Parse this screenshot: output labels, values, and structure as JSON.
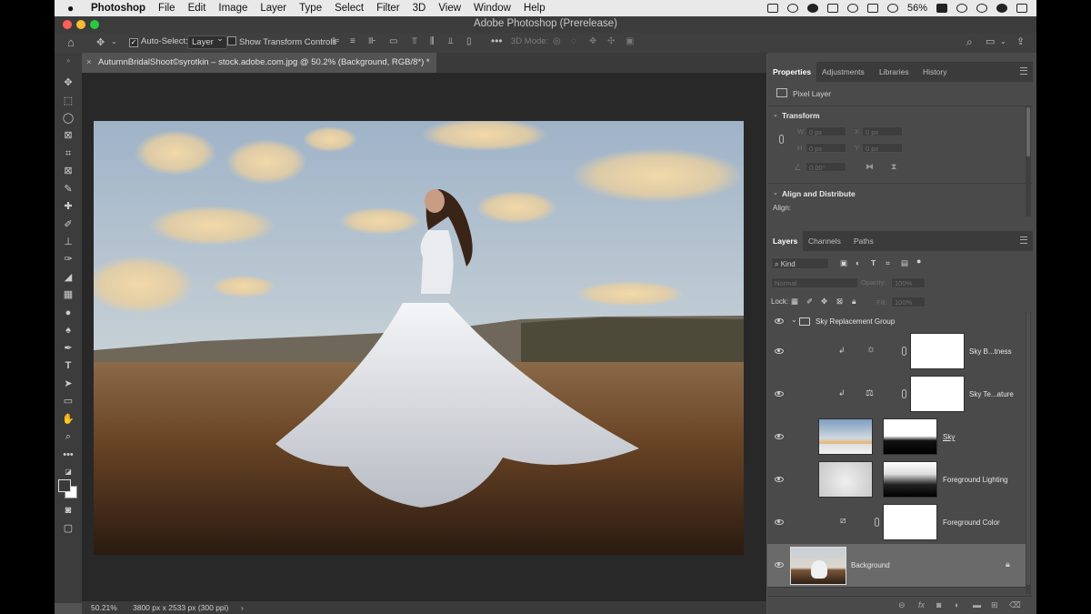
{
  "menubar": {
    "app": "Photoshop",
    "items": [
      "File",
      "Edit",
      "Image",
      "Layer",
      "Type",
      "Select",
      "Filter",
      "3D",
      "View",
      "Window",
      "Help"
    ],
    "battery": "56%"
  },
  "window": {
    "title": "Adobe Photoshop (Prerelease)"
  },
  "options": {
    "auto_select_label": "Auto-Select:",
    "auto_select_value": "Layer",
    "transform_controls_label": "Show Transform Controls",
    "mode_3d_label": "3D Mode:"
  },
  "document_tab": {
    "title": "AutumnBridalShoot©syrotkin – stock.adobe.com.jpg @ 50.2% (Background, RGB/8*) *"
  },
  "status": {
    "zoom": "50.21%",
    "doc_info": "3800 px x 2533 px (300 ppi)"
  },
  "properties_panel": {
    "tabs": [
      "Properties",
      "Adjustments",
      "Libraries",
      "History"
    ],
    "layer_type": "Pixel Layer",
    "transform_header": "Transform",
    "w_label": "W",
    "w_value": "0 px",
    "h_label": "H",
    "h_value": "0 px",
    "x_label": "X",
    "x_value": "0 px",
    "y_label": "Y",
    "y_value": "0 px",
    "angle_value": "0.00°",
    "align_header": "Align and Distribute",
    "align_label": "Align:"
  },
  "layers_panel": {
    "tabs": [
      "Layers",
      "Channels",
      "Paths"
    ],
    "kind_filter": "Kind",
    "blend_mode": "Normal",
    "opacity_label": "Opacity:",
    "opacity_value": "100%",
    "lock_label": "Lock:",
    "fill_label": "Fill:",
    "fill_value": "100%",
    "layers": [
      {
        "name": "Sky Replacement Group",
        "type": "group"
      },
      {
        "name": "Sky B...tness",
        "type": "adjustment"
      },
      {
        "name": "Sky Te...ature",
        "type": "adjustment"
      },
      {
        "name": "Sky",
        "type": "pixel"
      },
      {
        "name": "Foreground Lighting",
        "type": "pixel"
      },
      {
        "name": "Foreground Color",
        "type": "fill"
      },
      {
        "name": "Background",
        "type": "background"
      }
    ]
  },
  "colors": {
    "app_bg": "#535353",
    "panel_bg": "#4a4a4a",
    "selected_row": "#6a6a6a",
    "traffic_red": "#ff5f57",
    "traffic_yellow": "#febc2e",
    "traffic_green": "#28c840"
  }
}
